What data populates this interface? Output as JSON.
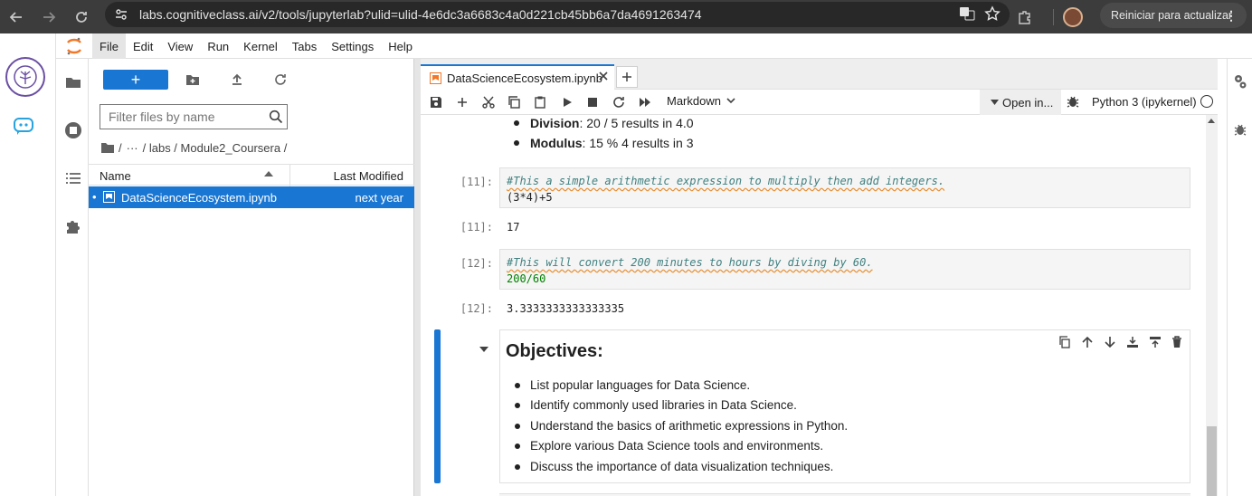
{
  "browser": {
    "url": "labs.cognitiveclass.ai/v2/tools/jupyterlab?ulid=ulid-4e6dc3a6683c4a0d221cb45bb6a7da4691263474",
    "update_label": "Reiniciar para actualizar"
  },
  "menu": {
    "items": [
      "File",
      "Edit",
      "View",
      "Run",
      "Kernel",
      "Tabs",
      "Settings",
      "Help"
    ]
  },
  "filebrowser": {
    "new_label": "+",
    "filter_placeholder": "Filter files by name",
    "breadcrumb": {
      "root": "/",
      "ellipsis": "···",
      "path": "/ labs / Module2_Coursera /"
    },
    "columns": {
      "name": "Name",
      "modified": "Last Modified"
    },
    "files": [
      {
        "name": "DataScienceEcosystem.ipynb",
        "modified": "next year"
      }
    ]
  },
  "notebook": {
    "tab_title": "DataScienceEcosystem.ipynb",
    "cell_type": "Markdown",
    "open_in": "Open in...",
    "kernel": "Python 3 (ipykernel)",
    "top_list": [
      {
        "bold": "Division",
        "rest": ": 20 / 5 results in 4.0"
      },
      {
        "bold": "Modulus",
        "rest": ": 15 % 4 results in 3"
      }
    ],
    "cells": [
      {
        "prompt": "[11]:",
        "comment": "#This a simple arithmetic expression to multiply then add integers.",
        "code": "(3*4)+5",
        "out_prompt": "[11]:",
        "output": "17"
      },
      {
        "prompt": "[12]:",
        "comment": "#This will convert 200 minutes to hours by diving by 60.",
        "code": "200/60",
        "out_prompt": "[12]:",
        "output": "3.3333333333333335"
      }
    ],
    "md_cell": {
      "title": "Objectives:",
      "items": [
        "List popular languages for Data Science.",
        "Identify commonly used libraries in Data Science.",
        "Understand the basics of arithmetic expressions in Python.",
        "Explore various Data Science tools and environments.",
        "Discuss the importance of data visualization techniques."
      ]
    }
  },
  "colors": {
    "accent": "#1976d2",
    "browser_bg": "#3c3c3c",
    "logo_orange": "#f37726"
  }
}
